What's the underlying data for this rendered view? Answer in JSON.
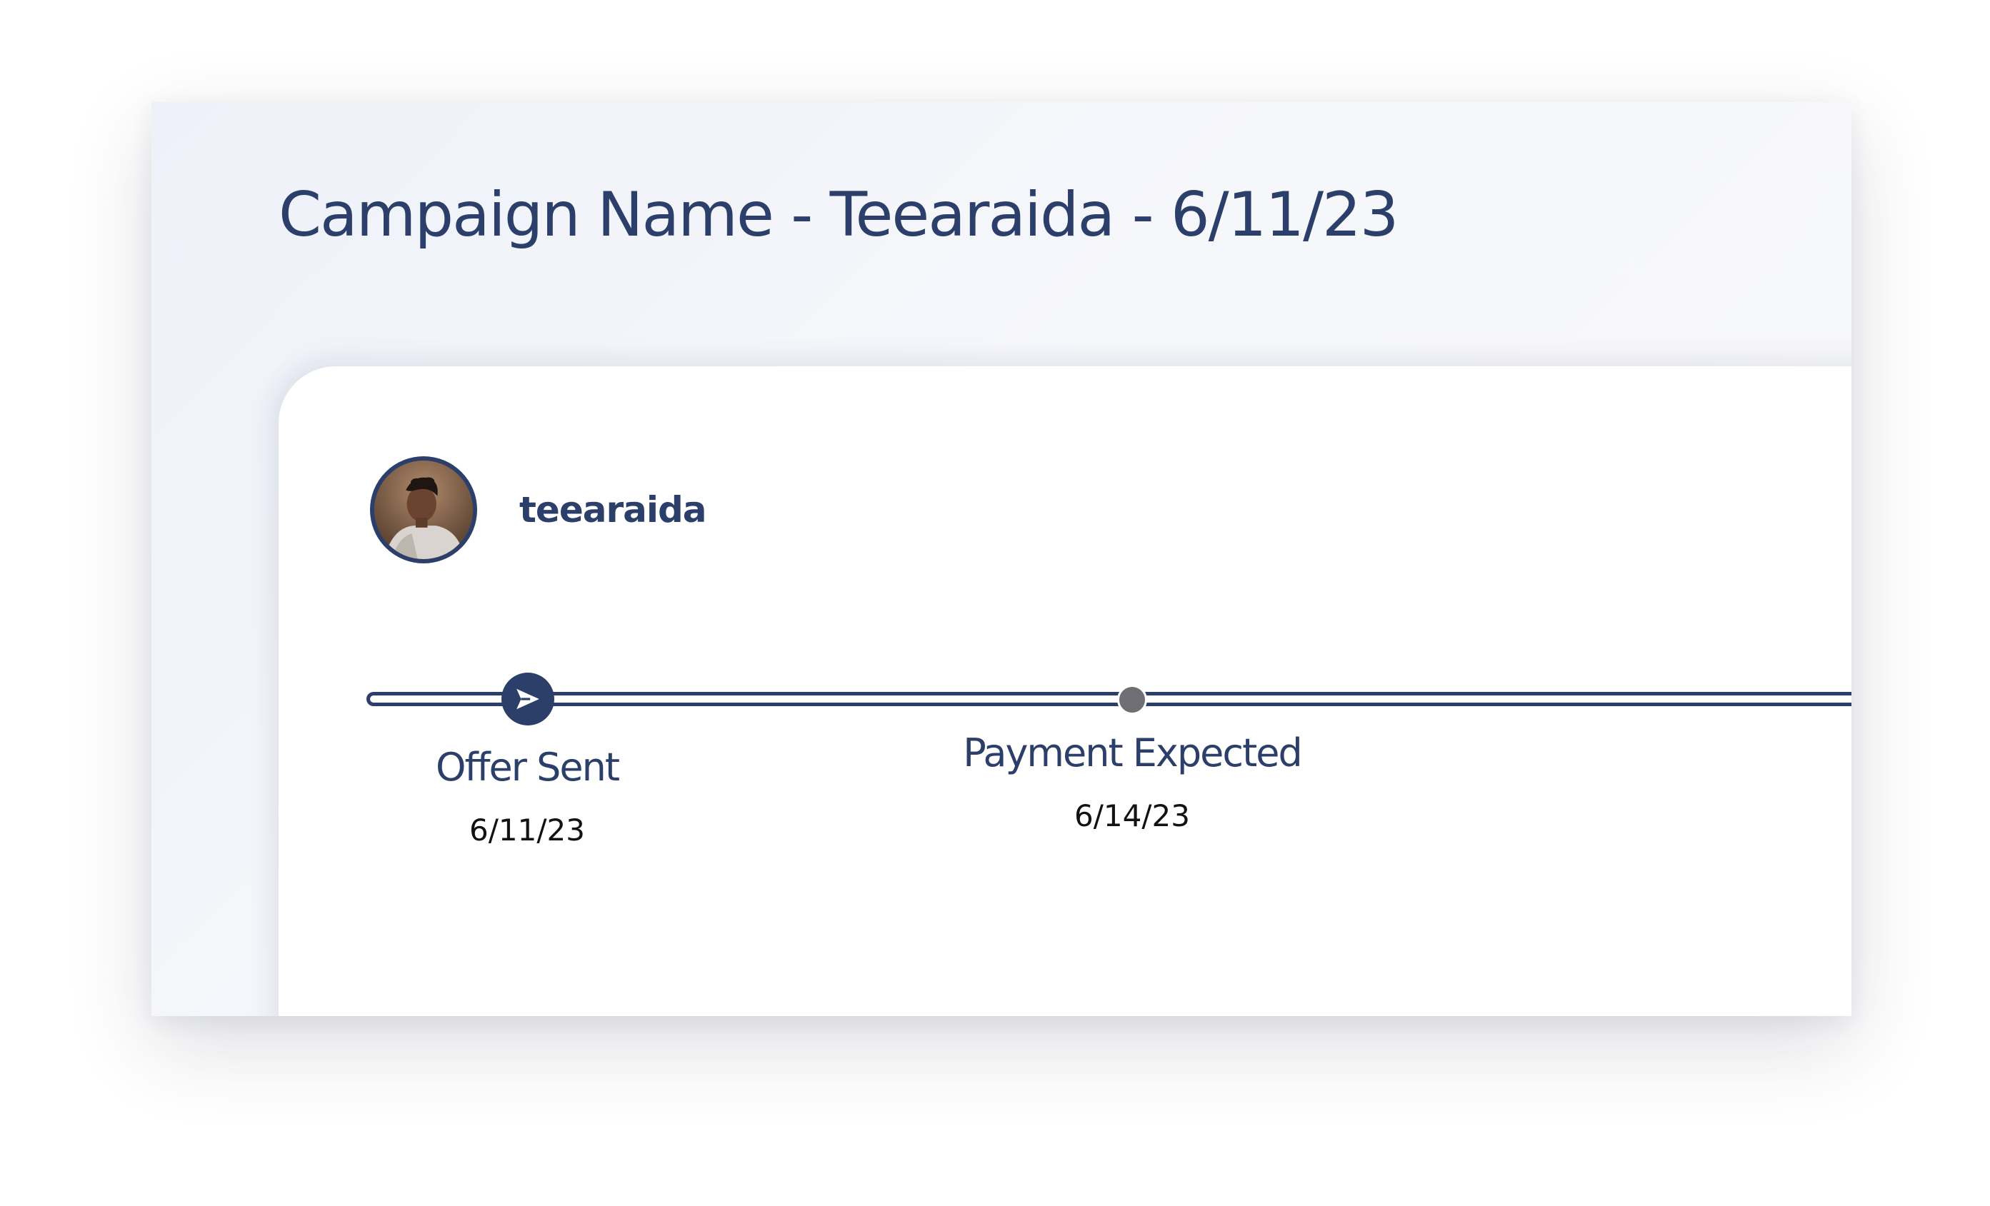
{
  "page": {
    "title": "Campaign Name - Teearaida - 6/11/23"
  },
  "creator": {
    "username": "teearaida",
    "avatar_icon": "avatar-photo"
  },
  "timeline": {
    "steps": [
      {
        "label": "Offer Sent",
        "date": "6/11/23",
        "status": "active",
        "icon": "send-icon"
      },
      {
        "label": "Payment Expected",
        "date": "6/14/23",
        "status": "pending",
        "icon": "pending-dot-icon"
      }
    ]
  },
  "colors": {
    "primary": "#2c3f6a",
    "pending": "#6e6e74",
    "date_text": "#121212",
    "background": "#f4f5fa"
  }
}
